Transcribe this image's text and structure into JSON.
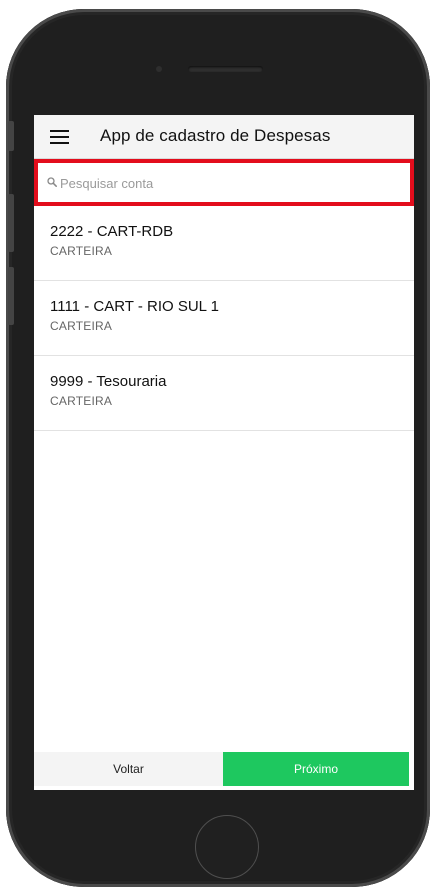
{
  "header": {
    "title": "App de cadastro de Despesas",
    "menu_icon": "menu-icon"
  },
  "search": {
    "placeholder": "Pesquisar conta",
    "value": "",
    "icon": "search-icon",
    "highlight_color": "#e30d1c"
  },
  "accounts": [
    {
      "title": "2222 - CART-RDB",
      "subtitle": "CARTEIRA"
    },
    {
      "title": "1111 - CART - RIO SUL 1",
      "subtitle": "CARTEIRA"
    },
    {
      "title": "9999 - Tesouraria",
      "subtitle": "CARTEIRA"
    }
  ],
  "footer": {
    "back_label": "Voltar",
    "next_label": "Próximo",
    "next_color": "#1ec85f"
  }
}
